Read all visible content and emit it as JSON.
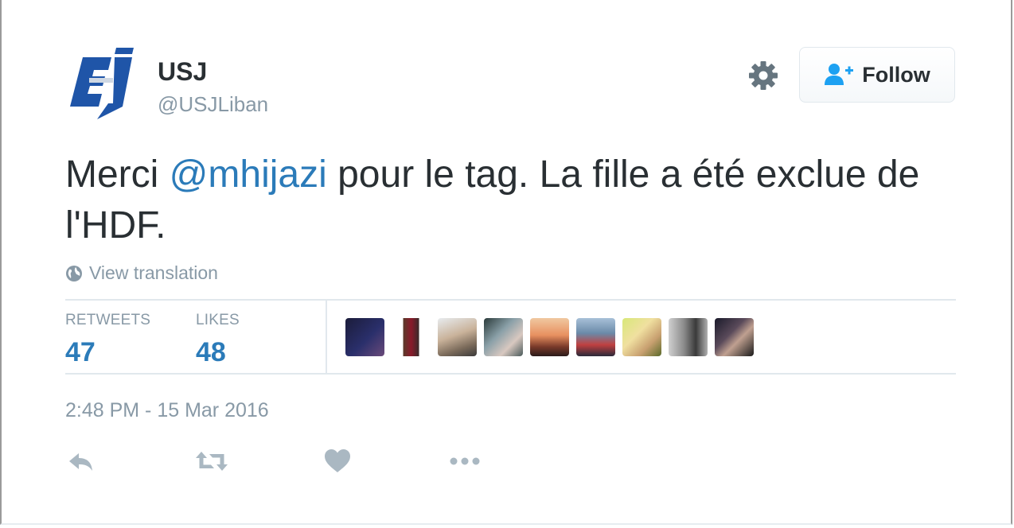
{
  "user": {
    "name": "USJ",
    "handle": "@USJLiban"
  },
  "follow_button": {
    "label": "Follow"
  },
  "tweet": {
    "text_before": "Merci ",
    "mention": "@mhijazi",
    "text_after": " pour le tag. La fille a été exclue de l'HDF."
  },
  "translation": {
    "label": "View translation"
  },
  "stats": {
    "retweets_label": "RETWEETS",
    "retweets_count": "47",
    "likes_label": "LIKES",
    "likes_count": "48"
  },
  "timestamp": "2:48 PM - 15 Mar 2016",
  "colors": {
    "link": "#2b7bb9",
    "muted": "#8899a6",
    "text": "#292f33",
    "logo_blue": "#1f55a8"
  },
  "icons": [
    "gear-icon",
    "follow-user-icon",
    "globe-icon",
    "reply-icon",
    "retweet-icon",
    "heart-icon",
    "more-icon"
  ]
}
